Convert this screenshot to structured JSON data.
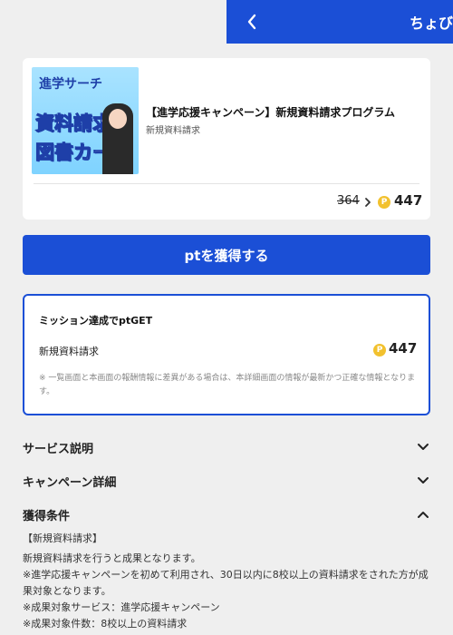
{
  "header": {
    "title": "ちょびリッチ",
    "back_icon": "chevron-left-icon",
    "bg_color": "#1b4fd6"
  },
  "offer": {
    "thumbnail": {
      "line_top": "進学サーチ",
      "line_1": "資料請求で",
      "line_2": "図書カード"
    },
    "title": "【進学応援キャンペーン】新規資料請求プログラム",
    "subtitle": "新規資料請求",
    "old_points": "364",
    "new_points": "447",
    "coin_icon": "P"
  },
  "cta": {
    "label": "ptを獲得する"
  },
  "mission": {
    "title": "ミッション達成でptGET",
    "item_label": "新規資料請求",
    "item_points": "447",
    "note": "※ 一覧画面と本画面の報酬情報に差異がある場合は、本詳細画面の情報が最新かつ正確な情報となります。"
  },
  "accordions": [
    {
      "label": "サービス説明",
      "state": "collapsed"
    },
    {
      "label": "キャンペーン詳細",
      "state": "collapsed"
    },
    {
      "label": "獲得条件",
      "state": "expanded"
    }
  ],
  "conditions": {
    "heading": "【新規資料請求】",
    "line_1": "新規資料請求を行うと成果となります。",
    "line_2": "※進学応援キャンペーンを初めて利用され、30日以内に8校以上の資料請求をされた方が成果対象となります。",
    "line_3": "※成果対象サービス：進学応援キャンペーン",
    "line_4": "※成果対象件数：8校以上の資料請求"
  }
}
